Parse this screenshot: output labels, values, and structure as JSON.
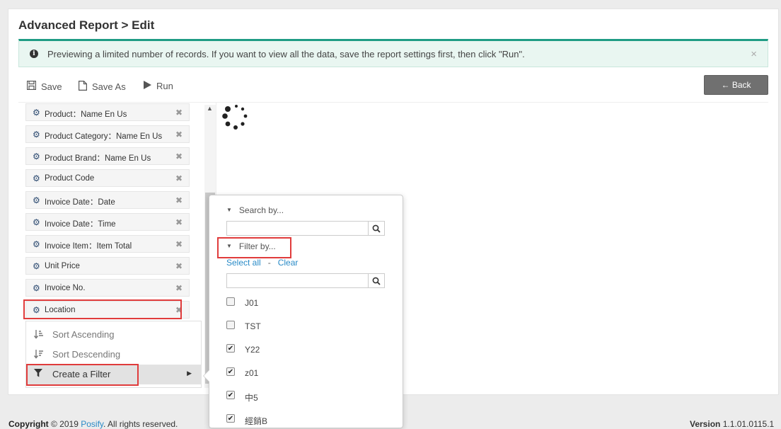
{
  "page": {
    "title": "Advanced Report > Edit"
  },
  "alert": {
    "message": "Previewing a limited number of records. If you want to view all the data, save the report settings first, then click \"Run\".",
    "close": "×"
  },
  "toolbar": {
    "save": "Save",
    "save_as": "Save As",
    "run": "Run",
    "back": "← Back"
  },
  "fields": [
    {
      "label": "Product：Name En Us"
    },
    {
      "label": "Product Category：Name En Us"
    },
    {
      "label": "Product Brand：Name En Us"
    },
    {
      "label": "Product Code"
    },
    {
      "label": "Invoice Date：Date"
    },
    {
      "label": "Invoice Date：Time"
    },
    {
      "label": "Invoice Item：Item Total"
    },
    {
      "label": "Unit Price"
    },
    {
      "label": "Invoice No."
    },
    {
      "label": "Location"
    }
  ],
  "context_menu": {
    "sort_asc": "Sort Ascending",
    "sort_desc": "Sort Descending",
    "create_filter": "Create a Filter"
  },
  "filter_popup": {
    "search_heading": "Search by...",
    "search_value": "",
    "filter_heading": "Filter by...",
    "select_all": "Select all",
    "separator": "-",
    "clear": "Clear",
    "filter_value": "",
    "options": [
      {
        "label": "J01",
        "checked": false
      },
      {
        "label": "TST",
        "checked": false
      },
      {
        "label": "Y22",
        "checked": true
      },
      {
        "label": "z01",
        "checked": true
      },
      {
        "label": "中5",
        "checked": true
      },
      {
        "label": "經銷B",
        "checked": true
      }
    ]
  },
  "footer": {
    "copyright_bold": "Copyright",
    "copyright_rest": " © 2019 ",
    "company": "Posify",
    "rights": ". All rights reserved.",
    "version_label": "Version",
    "version": "1.1.01.0115.1"
  },
  "colors": {
    "accent": "#1f9c84",
    "link": "#2a8bc7",
    "highlight": "#e03c3c",
    "gear": "#2c4a70"
  }
}
